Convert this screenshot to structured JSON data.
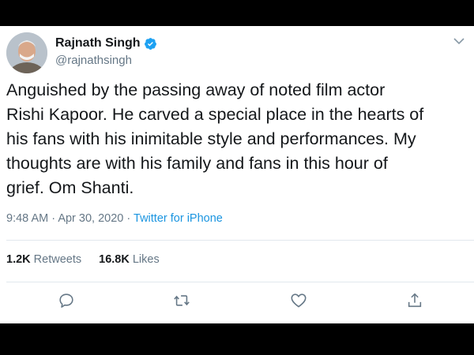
{
  "user": {
    "display_name": "Rajnath Singh",
    "handle": "@rajnathsingh",
    "verified": true
  },
  "tweet": {
    "text": "Anguished by the passing away of noted film actor\nRishi Kapoor. He carved a special place in the hearts of\nhis fans with his inimitable style and performances. My\nthoughts are with his family and fans in this hour of\ngrief. Om Shanti.",
    "time": "9:48 AM",
    "date": "Apr 30, 2020",
    "separator": "·",
    "source": "Twitter for iPhone"
  },
  "stats": {
    "retweets_count": "1.2K",
    "retweets_label": "Retweets",
    "likes_count": "16.8K",
    "likes_label": "Likes"
  },
  "actions": {
    "reply_icon": "reply-icon",
    "retweet_icon": "retweet-icon",
    "like_icon": "heart-icon",
    "share_icon": "share-icon"
  },
  "colors": {
    "text": "#14171a",
    "secondary": "#657786",
    "accent": "#1b95e0",
    "divider": "#e1e8ed",
    "background_frame": "#000000"
  }
}
